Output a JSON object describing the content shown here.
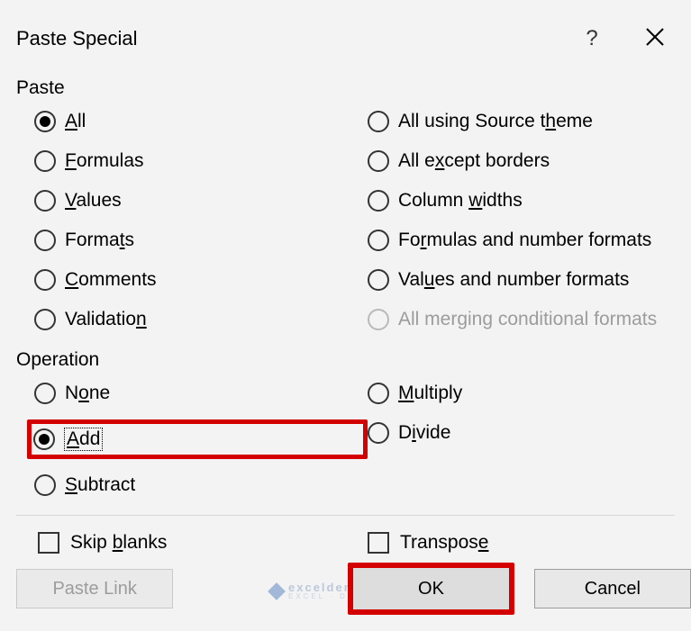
{
  "title": "Paste Special",
  "sections": {
    "paste": "Paste",
    "operation": "Operation"
  },
  "paste_left": {
    "all": "ll",
    "formulas": "ormulas",
    "values": "alues",
    "formats": "Forma",
    "formats2": "s",
    "comments": "omments",
    "validation": "Validatio"
  },
  "paste_right": {
    "theme1": "All using Source t",
    "theme2": "eme",
    "except": "All e",
    "except2": "cept borders",
    "widths1": "Column ",
    "widths2": "idths",
    "num1": "Fo",
    "num2": "mulas and number formats",
    "valnum1": "Val",
    "valnum2": "es and number formats",
    "merge": "All merging conditional formats"
  },
  "op_left": {
    "none": "N",
    "none2": "ne",
    "add": "dd",
    "sub": "ubtract"
  },
  "op_right": {
    "mult": "ultiply",
    "div": "D",
    "div2": "vide"
  },
  "checks": {
    "skip": "Skip ",
    "skip2": "lanks",
    "trans": "Transpos"
  },
  "buttons": {
    "pastelink": "Paste Link",
    "ok": "OK",
    "cancel": "Cancel"
  },
  "watermark": {
    "brand": "exceldemy",
    "sub": "EXCEL · DATA · BI"
  }
}
